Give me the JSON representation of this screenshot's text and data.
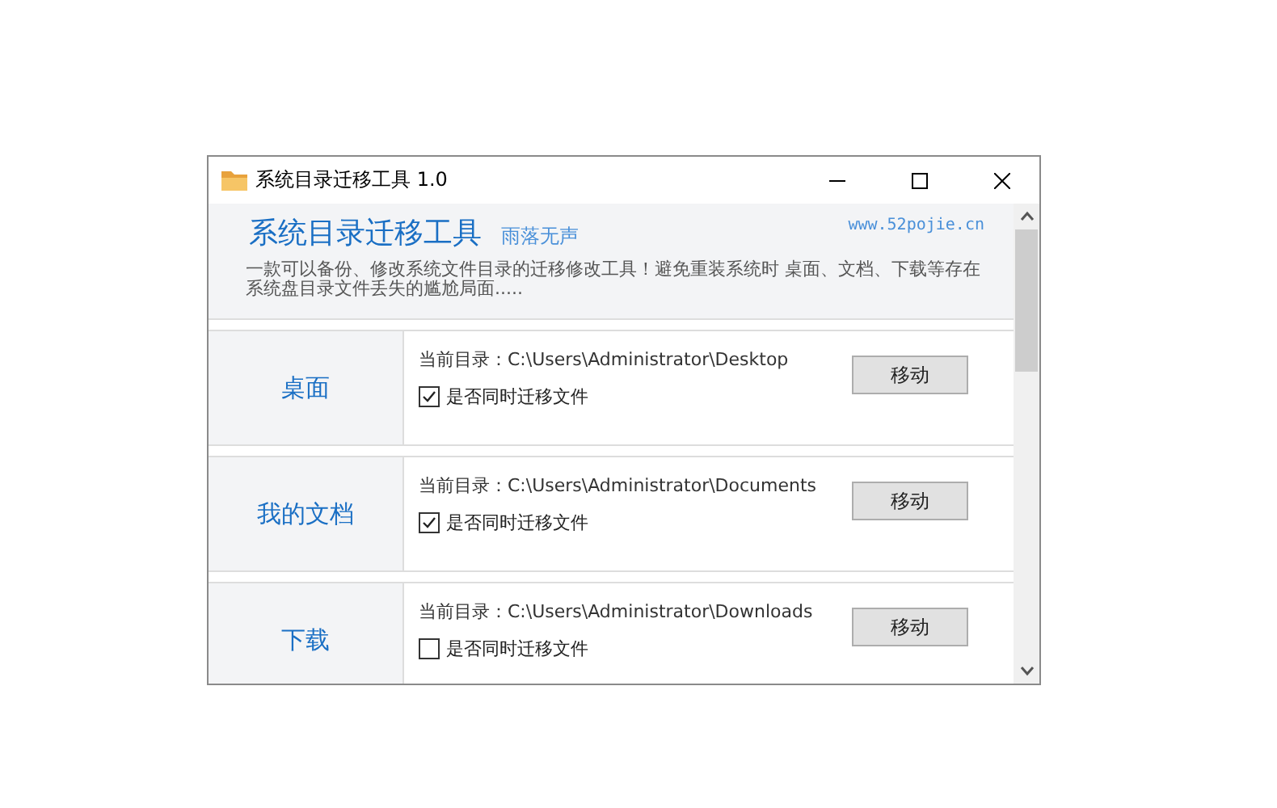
{
  "window": {
    "title": "系统目录迁移工具 1.0"
  },
  "header": {
    "title": "系统目录迁移工具",
    "author": "雨落无声",
    "website": "www.52pojie.cn",
    "description": "一款可以备份、修改系统文件目录的迁移修改工具！避免重装系统时 桌面、文档、下载等存在系统盘目录文件丢失的尴尬局面....."
  },
  "folders": [
    {
      "name": "桌面",
      "path": "当前目录：C:\\Users\\Administrator\\Desktop",
      "option": "是否同时迁移文件",
      "checked": true,
      "button": "移动"
    },
    {
      "name": "我的文档",
      "path": "当前目录：C:\\Users\\Administrator\\Documents",
      "option": "是否同时迁移文件",
      "checked": true,
      "button": "移动"
    },
    {
      "name": "下载",
      "path": "当前目录：C:\\Users\\Administrator\\Downloads",
      "option": "是否同时迁移文件",
      "checked": false,
      "button": "移动"
    }
  ]
}
